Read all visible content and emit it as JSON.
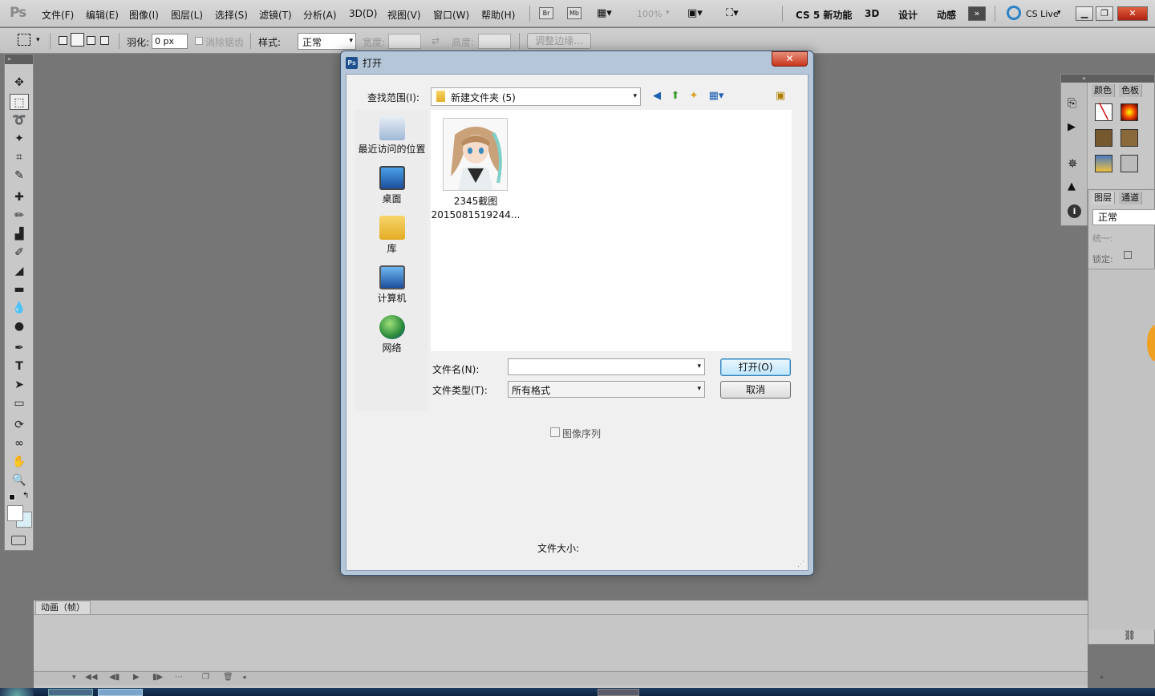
{
  "app": {
    "logo": "Ps",
    "menu": [
      "文件(F)",
      "编辑(E)",
      "图像(I)",
      "图层(L)",
      "选择(S)",
      "滤镜(T)",
      "分析(A)",
      "3D(D)",
      "视图(V)",
      "窗口(W)",
      "帮助(H)"
    ],
    "bridge_label": "Br",
    "minibridge_label": "Mb",
    "zoom": "100%",
    "workspaces": [
      "CS 5 新功能",
      "3D",
      "设计",
      "动感"
    ],
    "cs_live": "CS Live"
  },
  "options": {
    "feather_label": "羽化:",
    "feather_value": "0 px",
    "antialias_label": "消除锯齿",
    "style_label": "样式:",
    "style_value": "正常",
    "width_label": "宽度:",
    "height_label": "高度:",
    "refine_edge": "调整边缘..."
  },
  "animation_panel": {
    "tab": "动画（帧）"
  },
  "right_panels": {
    "tabs_top": [
      "颜色",
      "色板"
    ],
    "tabs_layers": [
      "图层",
      "通道"
    ],
    "blend_mode": "正常",
    "unify_label": "统一:",
    "lock_label": "锁定:"
  },
  "dialog": {
    "title": "打开",
    "close": "✕",
    "look_in_label": "查找范围(I):",
    "look_in_value": "新建文件夹 (5)",
    "places": [
      "最近访问的位置",
      "桌面",
      "库",
      "计算机",
      "网络"
    ],
    "file": {
      "name_line1": "2345截图",
      "name_line2": "2015081519244..."
    },
    "filename_label": "文件名(N):",
    "filename_value": "",
    "filetype_label": "文件类型(T):",
    "filetype_value": "所有格式",
    "open_button": "打开(O)",
    "cancel_button": "取消",
    "image_sequence": "图像序列",
    "file_size_label": "文件大小:"
  }
}
